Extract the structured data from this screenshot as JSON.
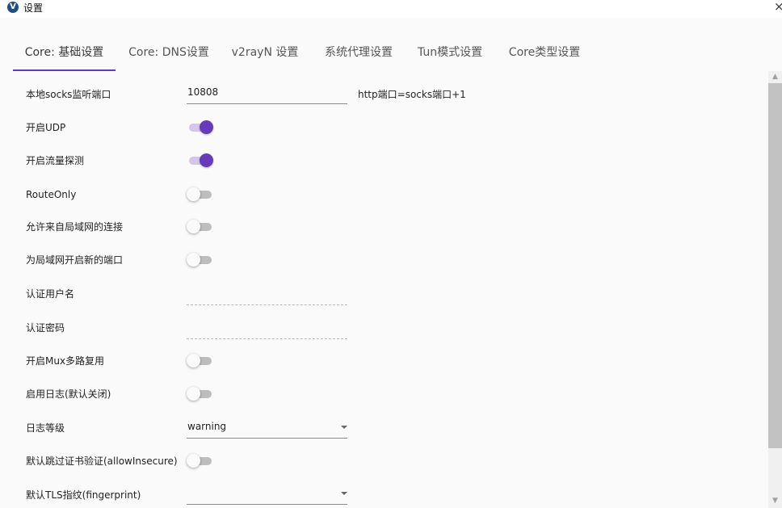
{
  "window": {
    "title": "设置",
    "close_glyph": "×"
  },
  "tabs": [
    {
      "label": "Core: 基础设置",
      "active": true
    },
    {
      "label": "Core: DNS设置",
      "active": false
    },
    {
      "label": "v2rayN 设置",
      "active": false
    },
    {
      "label": "系统代理设置",
      "active": false
    },
    {
      "label": "Tun模式设置",
      "active": false
    },
    {
      "label": "Core类型设置",
      "active": false
    }
  ],
  "accent_color": "#673ab7",
  "settings": {
    "socks_port": {
      "label": "本地socks监听端口",
      "value": "10808",
      "hint": "http端口=socks端口+1"
    },
    "enable_udp": {
      "label": "开启UDP",
      "on": true
    },
    "enable_sniffing": {
      "label": "开启流量探测",
      "on": true
    },
    "route_only": {
      "label": "RouteOnly",
      "on": false
    },
    "allow_lan": {
      "label": "允许来自局域网的连接",
      "on": false
    },
    "new_lan_port": {
      "label": "为局域网开启新的端口",
      "on": false
    },
    "auth_user": {
      "label": "认证用户名",
      "value": ""
    },
    "auth_pass": {
      "label": "认证密码",
      "value": ""
    },
    "enable_mux": {
      "label": "开启Mux多路复用",
      "on": false
    },
    "enable_log": {
      "label": "启用日志(默认关闭)",
      "on": false
    },
    "log_level": {
      "label": "日志等级",
      "value": "warning"
    },
    "allow_insecure": {
      "label": "默认跳过证书验证(allowInsecure)",
      "on": false
    },
    "fingerprint": {
      "label": "默认TLS指纹(fingerprint)",
      "value": ""
    }
  },
  "icons": {
    "app": "v2rayn-logo-icon",
    "scroll_up": "▲",
    "scroll_down": "▼"
  }
}
